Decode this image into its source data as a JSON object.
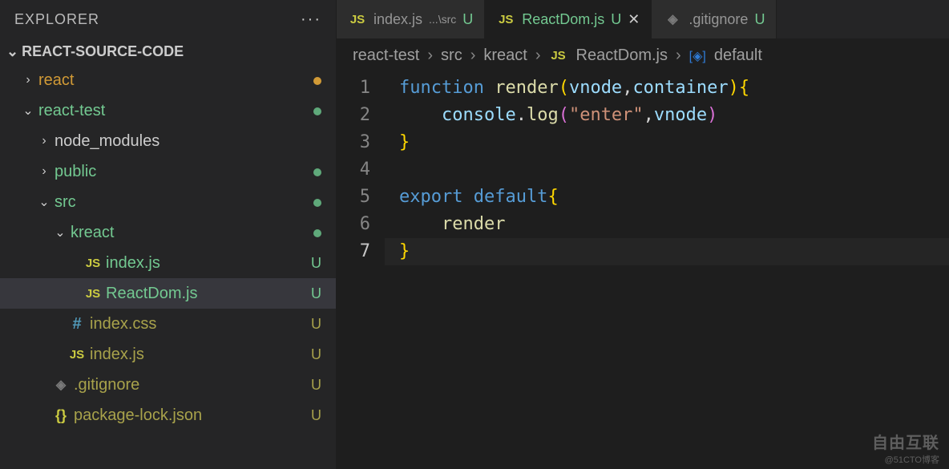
{
  "explorer": {
    "title": "EXPLORER"
  },
  "section": {
    "title": "REACT-SOURCE-CODE"
  },
  "tree": [
    {
      "indent": 26,
      "chev": "›",
      "label": "react",
      "class": "git-orange",
      "status_dot": "orange"
    },
    {
      "indent": 26,
      "chev": "⌄",
      "label": "react-test",
      "class": "git-green",
      "status_dot": "green"
    },
    {
      "indent": 46,
      "chev": "›",
      "label": "node_modules",
      "class": "",
      "status": ""
    },
    {
      "indent": 46,
      "chev": "›",
      "label": "public",
      "class": "git-green",
      "status_dot": "green"
    },
    {
      "indent": 46,
      "chev": "⌄",
      "label": "src",
      "class": "git-green",
      "status_dot": "green"
    },
    {
      "indent": 66,
      "chev": "⌄",
      "label": "kreact",
      "class": "git-green",
      "status_dot": "green"
    },
    {
      "indent": 86,
      "chev": "",
      "icon": "js",
      "icon_text": "JS",
      "label": "index.js",
      "class": "git-green",
      "status": "U"
    },
    {
      "indent": 86,
      "chev": "",
      "icon": "js",
      "icon_text": "JS",
      "label": "ReactDom.js",
      "class": "git-green",
      "status": "U",
      "active": true
    },
    {
      "indent": 66,
      "chev": "",
      "icon": "hash",
      "icon_text": "#",
      "label": "index.css",
      "class": "git-olive",
      "status": "U"
    },
    {
      "indent": 66,
      "chev": "",
      "icon": "js",
      "icon_text": "JS",
      "label": "index.js",
      "class": "git-olive",
      "status": "U"
    },
    {
      "indent": 46,
      "chev": "",
      "icon": "git",
      "icon_text": "◈",
      "label": ".gitignore",
      "class": "git-olive",
      "status": "U"
    },
    {
      "indent": 46,
      "chev": "",
      "icon": "braces",
      "icon_text": "{}",
      "label": "package-lock.json",
      "class": "git-olive",
      "status": "U"
    }
  ],
  "tabs": [
    {
      "icon": "JS",
      "label": "index.js",
      "dir": "...\\src",
      "git": "U",
      "active": false
    },
    {
      "icon": "JS",
      "label": "ReactDom.js",
      "git": "U",
      "active": true,
      "close": true
    },
    {
      "icon": "◈",
      "label": ".gitignore",
      "git": "U",
      "active": false
    }
  ],
  "breadcrumb": {
    "parts": [
      "react-test",
      "src",
      "kreact"
    ],
    "fileIcon": "JS",
    "file": "ReactDom.js",
    "symbolIcon": "[◈]",
    "symbol": "default"
  },
  "code": {
    "current_line": 7,
    "lines": [
      {
        "n": 1,
        "tokens": [
          {
            "t": "function ",
            "c": "kw"
          },
          {
            "t": "render",
            "c": "fn"
          },
          {
            "t": "(",
            "c": "brace-y"
          },
          {
            "t": "vnode",
            "c": "param"
          },
          {
            "t": ",",
            "c": "punct"
          },
          {
            "t": "container",
            "c": "param"
          },
          {
            "t": ")",
            "c": "brace-y"
          },
          {
            "t": "{",
            "c": "brace-y"
          }
        ]
      },
      {
        "n": 2,
        "tokens": [
          {
            "t": "    ",
            "c": ""
          },
          {
            "t": "console",
            "c": "param"
          },
          {
            "t": ".",
            "c": "punct"
          },
          {
            "t": "log",
            "c": "fn"
          },
          {
            "t": "(",
            "c": "brace-p"
          },
          {
            "t": "\"enter\"",
            "c": "str"
          },
          {
            "t": ",",
            "c": "punct"
          },
          {
            "t": "vnode",
            "c": "param"
          },
          {
            "t": ")",
            "c": "brace-p"
          }
        ]
      },
      {
        "n": 3,
        "tokens": [
          {
            "t": "}",
            "c": "brace-y"
          }
        ]
      },
      {
        "n": 4,
        "tokens": []
      },
      {
        "n": 5,
        "tokens": [
          {
            "t": "export default",
            "c": "kw"
          },
          {
            "t": "{",
            "c": "brace-y"
          }
        ]
      },
      {
        "n": 6,
        "tokens": [
          {
            "t": "    ",
            "c": ""
          },
          {
            "t": "render",
            "c": "fn"
          }
        ]
      },
      {
        "n": 7,
        "tokens": [
          {
            "t": "}",
            "c": "brace-y"
          }
        ]
      }
    ]
  },
  "watermark": {
    "main": "自由互联",
    "sub": "@51CTO博客"
  }
}
